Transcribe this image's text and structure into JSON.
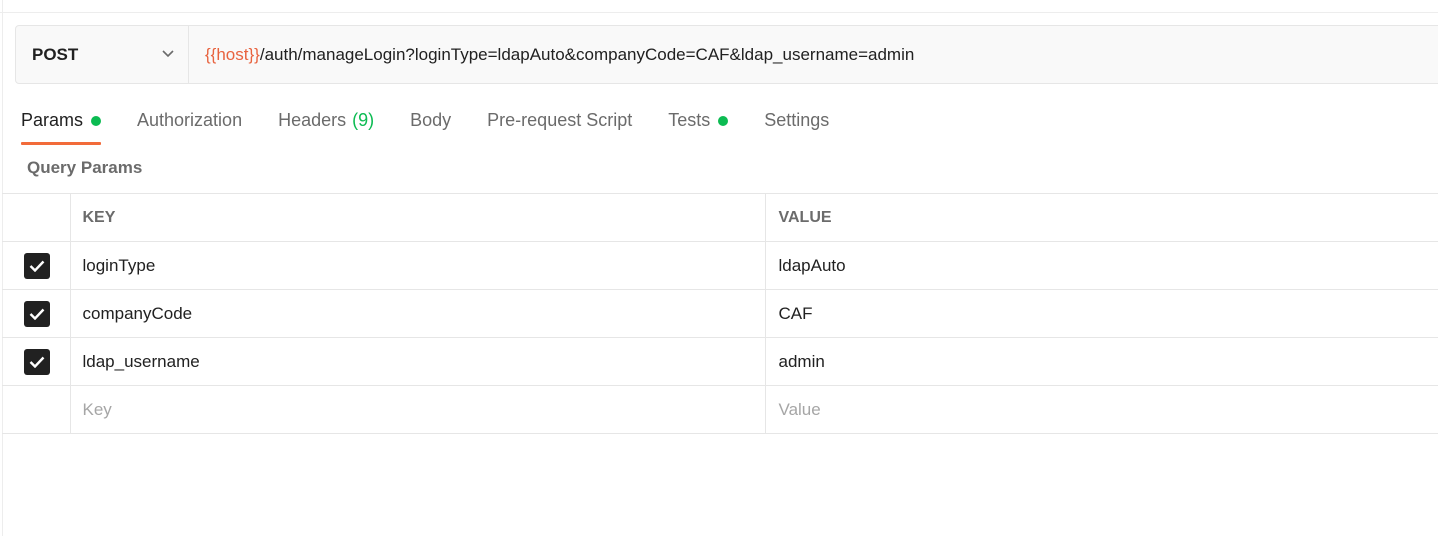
{
  "request": {
    "method": "POST",
    "url_variable": "{{host}}",
    "url_path": "/auth/manageLogin?loginType=ldapAuto&companyCode=CAF&ldap_username=admin"
  },
  "tabs": [
    {
      "label": "Params",
      "active": true,
      "dot": true
    },
    {
      "label": "Authorization"
    },
    {
      "label": "Headers",
      "count": "(9)"
    },
    {
      "label": "Body"
    },
    {
      "label": "Pre-request Script"
    },
    {
      "label": "Tests",
      "dot": true
    },
    {
      "label": "Settings"
    }
  ],
  "query_params": {
    "title": "Query Params",
    "headers": {
      "key": "KEY",
      "value": "VALUE"
    },
    "rows": [
      {
        "key": "loginType",
        "value": "ldapAuto",
        "checked": true
      },
      {
        "key": "companyCode",
        "value": "CAF",
        "checked": true
      },
      {
        "key": "ldap_username",
        "value": "admin",
        "checked": true
      }
    ],
    "new_row": {
      "key_placeholder": "Key",
      "value_placeholder": "Value"
    }
  },
  "colors": {
    "accent": "#f26b3a",
    "variable": "#e8633f",
    "status_dot": "#0cbb52"
  }
}
